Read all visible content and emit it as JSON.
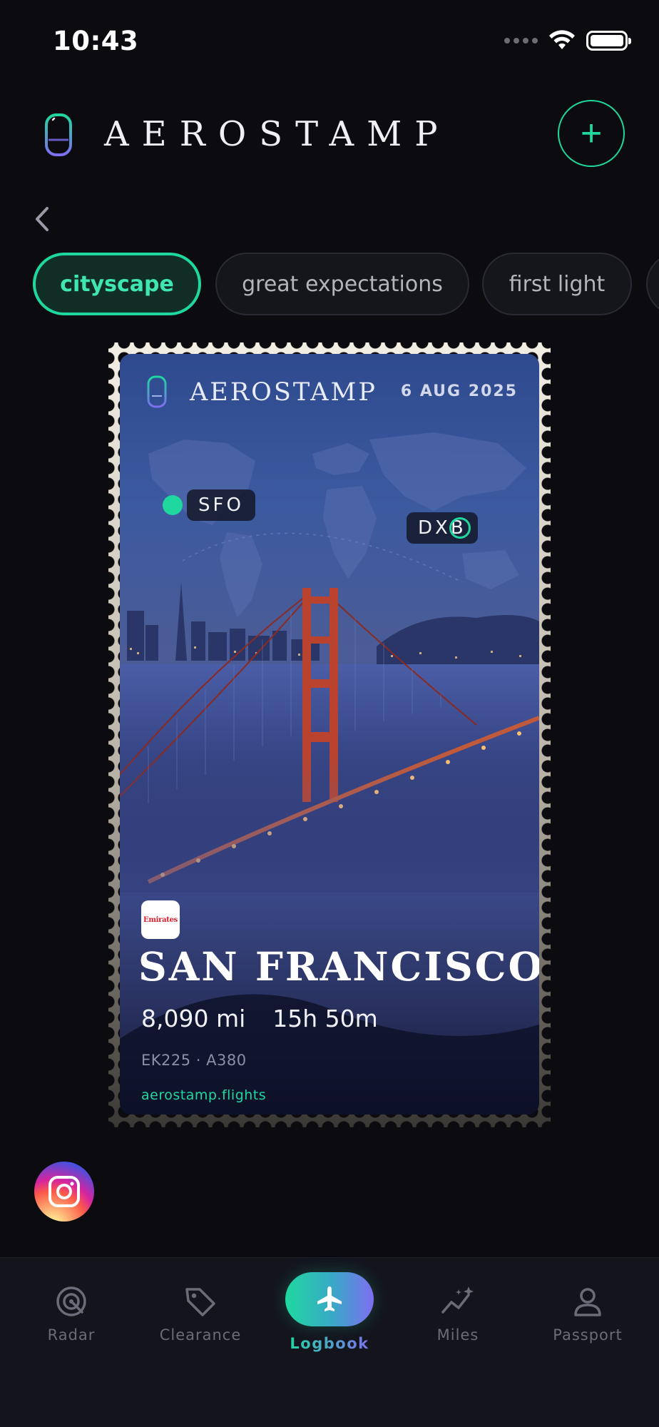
{
  "status_bar": {
    "time": "10:43"
  },
  "header": {
    "app_title": "AEROSTAMP",
    "add_label": "+"
  },
  "chips": [
    {
      "label": "cityscape",
      "active": true
    },
    {
      "label": "great expectations",
      "active": false
    },
    {
      "label": "first light",
      "active": false
    }
  ],
  "stamp": {
    "brand": "AEROSTAMP",
    "date": "6 AUG 2025",
    "origin": "SFO",
    "destination": "DXB",
    "airline": "Emirates",
    "city": "SAN FRANCISCO",
    "distance": "8,090 mi",
    "duration": "15h 50m",
    "flight_info": "EK225 · A380",
    "url": "aerostamp.flights"
  },
  "tabs": [
    {
      "label": "Radar",
      "icon": "radar-icon"
    },
    {
      "label": "Clearance",
      "icon": "tag-icon"
    },
    {
      "label": "Logbook",
      "icon": "plane-icon",
      "active": true
    },
    {
      "label": "Miles",
      "icon": "sparkline-icon"
    },
    {
      "label": "Passport",
      "icon": "user-icon"
    }
  ],
  "colors": {
    "accent": "#1fd8a0",
    "accent_secondary": "#7e6ef0",
    "background": "#0b0b10"
  }
}
